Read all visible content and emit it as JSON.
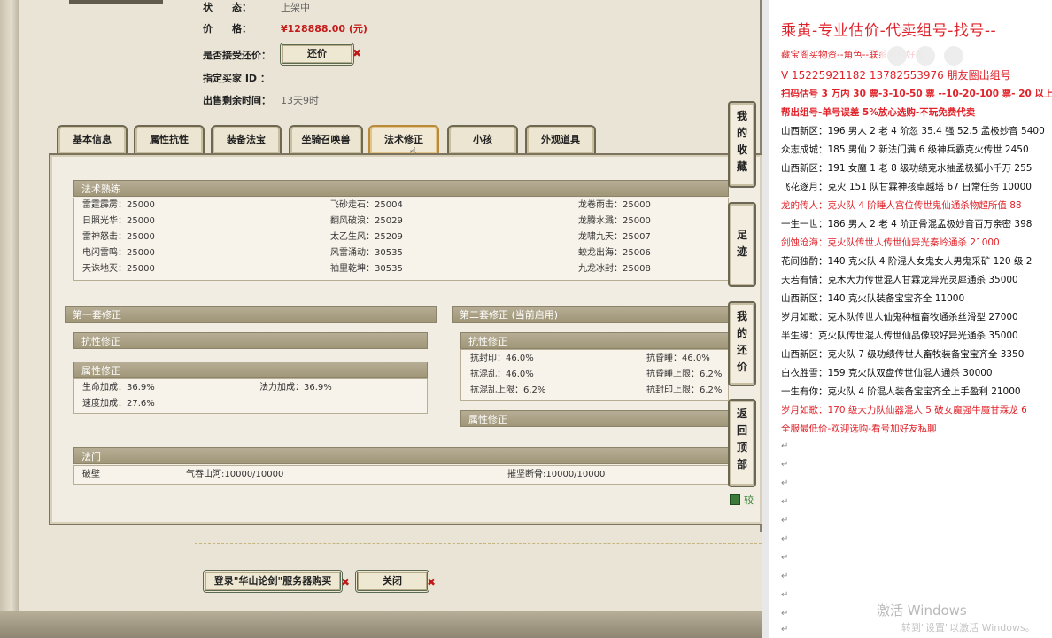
{
  "item": {
    "status_label": "状　　态：",
    "status_value": "上架中",
    "price_label": "价　　格：",
    "price_value": "¥128888.00 (元)",
    "bargain_label": "是否接受还价：",
    "bargain_button": "还价",
    "buyer_label": "指定买家 ID ：",
    "buyer_value": "",
    "time_label": "出售剩余时间：",
    "time_value": "13天9时"
  },
  "tabs": [
    {
      "label": "基本信息",
      "active": false
    },
    {
      "label": "属性抗性",
      "active": false
    },
    {
      "label": "装备法宝",
      "active": false
    },
    {
      "label": "坐骑召唤兽",
      "active": false
    },
    {
      "label": "法术修正",
      "active": true
    },
    {
      "label": "小孩",
      "active": false
    },
    {
      "label": "外观道具",
      "active": false
    }
  ],
  "skill_proficiency": {
    "title": "法术熟练",
    "rows": [
      [
        "雷霆霹雳：25000",
        "飞砂走石：25004",
        "龙卷雨击：25000"
      ],
      [
        "日照光华：25000",
        "翻风破浪：25029",
        "龙腾水溅：25000"
      ],
      [
        "雷神怒击：25000",
        "太乙生风：25209",
        "龙啸九天：25007"
      ],
      [
        "电闪雷鸣：25000",
        "风雷涌动：30535",
        "蛟龙出海：25006"
      ],
      [
        "天诛地灭：25000",
        "袖里乾坤：30535",
        "九龙冰封：25008"
      ]
    ]
  },
  "set1": {
    "title": "第一套修正",
    "resist_title": "抗性修正",
    "attr_title": "属性修正",
    "attrs": [
      "生命加成：36.9%",
      "法力加成：36.9%",
      "速度加成：27.6%"
    ]
  },
  "set2": {
    "title": "第二套修正 (当前启用)",
    "resist_title": "抗性修正",
    "resists": [
      "抗封印：46.0%",
      "抗昏睡：46.0%",
      "抗混乱：46.0%",
      "抗昏睡上限：6.2%",
      "抗混乱上限：6.2%",
      "抗封印上限：6.2%"
    ],
    "attr_title": "属性修正"
  },
  "fame": {
    "title": "法门",
    "cells": [
      "破壁",
      "气吞山河:10000/10000",
      "摧坚断骨:10000/10000"
    ]
  },
  "side_nav": [
    "我的收藏",
    "足迹",
    "我的还价",
    "返回顶部"
  ],
  "calc_text": "较",
  "bottom_buttons": {
    "buy": "登录\"华山论剑\"服务器购买",
    "close": "关闭"
  },
  "doc": {
    "title": "乘黄-专业估价-代卖组号-找号--",
    "lines": [
      {
        "text": "藏宝阁买物资--角色--联系我机好友",
        "style": "red"
      },
      {
        "text": "V 15225921182   13782553976 朋友圈出组号",
        "style": "red"
      },
      {
        "text": "扫码估号 3 万内 30 票-3-10-50 票  --10-20-100 票- 20 以上",
        "style": "red bold"
      },
      {
        "text": "帮出组号-单号误差 5%放心选购-不玩免费代卖",
        "style": "red bold"
      },
      {
        "text": "山西新区：196 男人 2 老 4 阶忽 35.4 强 52.5 孟极妙音 5400",
        "style": ""
      },
      {
        "text": "众志成城：185 男仙 2 新法门满 6 级神兵霸克火传世 2450",
        "style": ""
      },
      {
        "text": "山西新区：191 女魔 1 老 8 级功绩克水抽孟极狐小千万 255",
        "style": ""
      },
      {
        "text": "飞花逐月：克火 151 队甘霖神孩卓越塔 67 日常任务 10000",
        "style": ""
      },
      {
        "text": "龙的传人：克火队 4 阶睡人宫位传世鬼仙通杀物超所值 88",
        "style": "red"
      },
      {
        "text": "一生一世：186 男人 2 老 4 阶正骨混孟极妙音百万亲密 398",
        "style": ""
      },
      {
        "text": "剑蚀沧海：克火队传世人传世仙异光秦岭通杀 21000",
        "style": "red"
      },
      {
        "text": "花间独酌：140 克火队 4 阶混人女鬼女人男鬼采矿 120 级 2",
        "style": ""
      },
      {
        "text": "天若有情：克木大力传世混人甘霖龙异光灵犀通杀 35000",
        "style": ""
      },
      {
        "text": "山西新区：140 克火队装备宝宝齐全 11000",
        "style": ""
      },
      {
        "text": "岁月如歌：克木队传世人仙鬼种植畜牧通杀丝滑型 27000",
        "style": ""
      },
      {
        "text": "半生缘：克火队传世混人传世仙品像较好异光通杀 35000",
        "style": ""
      },
      {
        "text": "山西新区：克火队 7 级功绩传世人畜牧装备宝宝齐全 3350",
        "style": ""
      },
      {
        "text": "白衣胜雪：159 克火队双盘传世仙混人通杀 30000",
        "style": ""
      },
      {
        "text": "一生有你：克火队 4 阶混人装备宝宝齐全上手盈利 21000",
        "style": ""
      },
      {
        "text": "岁月如歌：170 级大力队仙器混人 5 破女魔强牛魔甘霖龙 6",
        "style": "red"
      },
      {
        "text": "全服最低价-欢迎选购-看号加好友私聊",
        "style": "red"
      }
    ],
    "para_mark": "↵",
    "watermark_title": "激活 Windows",
    "watermark_sub": "转到\"设置\"以激活 Windows。"
  }
}
